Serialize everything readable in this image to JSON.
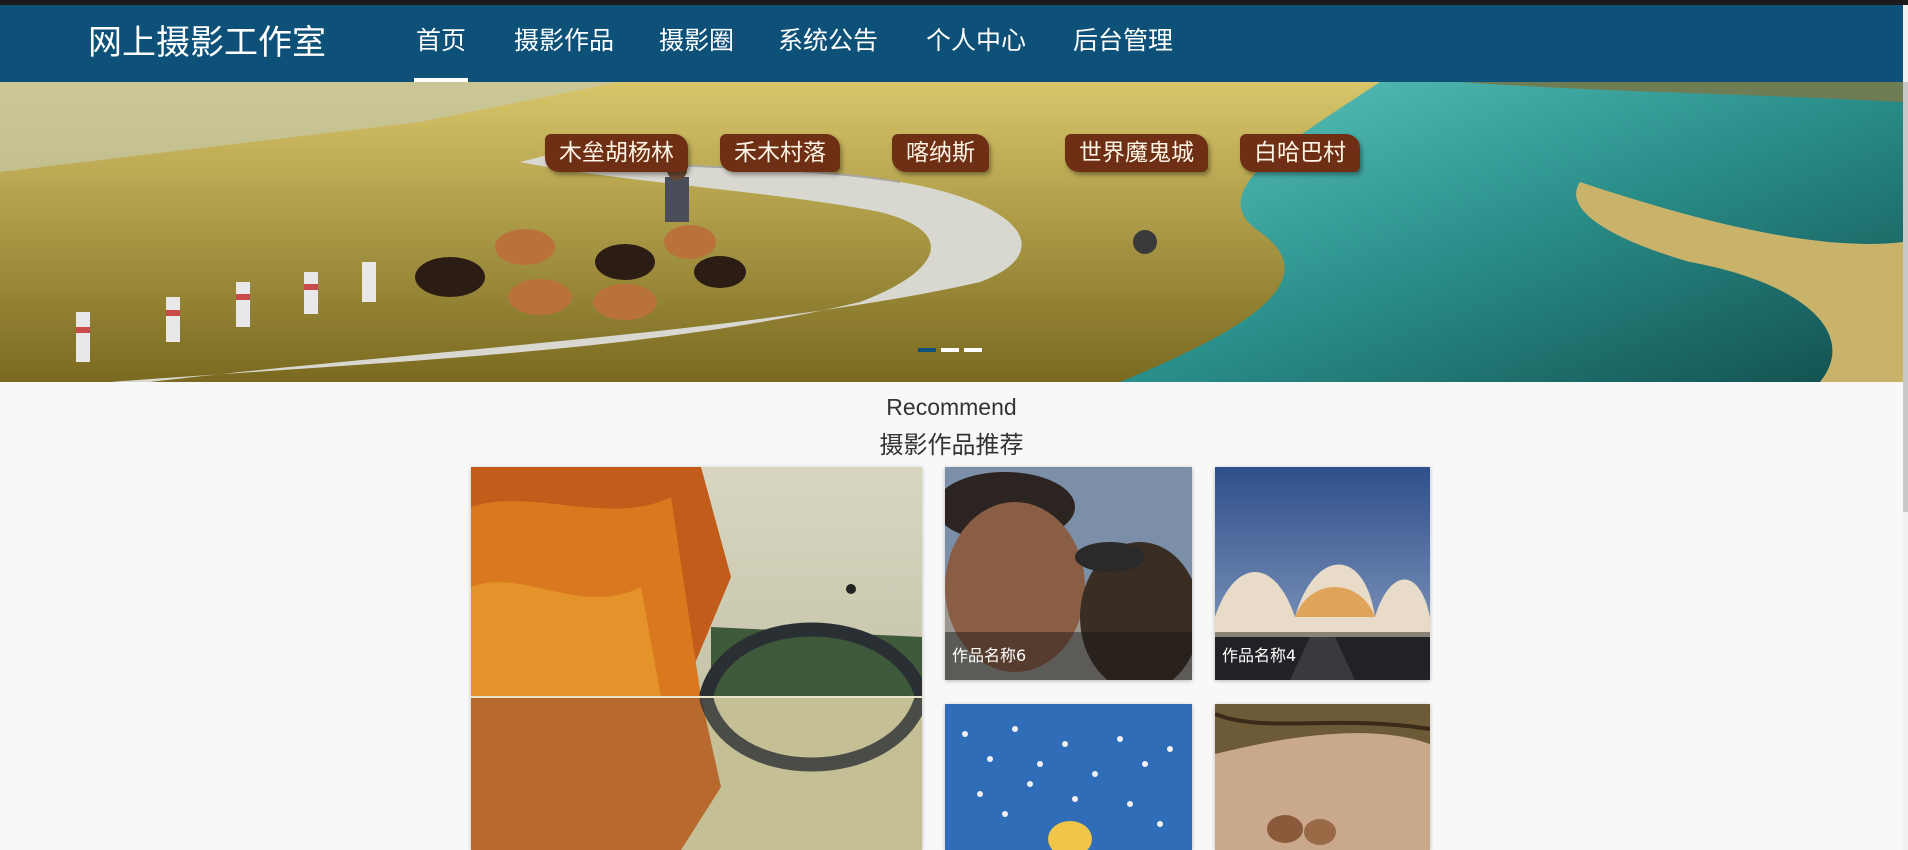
{
  "header": {
    "brand": "网上摄影工作室",
    "nav": [
      {
        "label": "首页",
        "active": true
      },
      {
        "label": "摄影作品",
        "active": false
      },
      {
        "label": "摄影圈",
        "active": false
      },
      {
        "label": "系统公告",
        "active": false
      },
      {
        "label": "个人中心",
        "active": false
      },
      {
        "label": "后台管理",
        "active": false
      }
    ]
  },
  "banner": {
    "tags": [
      "木垒胡杨林",
      "禾木村落",
      "喀纳斯",
      "世界魔鬼城",
      "白哈巴村"
    ],
    "slides": 3,
    "active_slide": 1,
    "colors": {
      "active": "#0d5179",
      "inactive": "#ffffff"
    }
  },
  "recommend": {
    "title_en": "Recommend",
    "title_cn": "摄影作品推荐",
    "works": [
      {
        "name": "",
        "image": "autumn-bridge-reflection"
      },
      {
        "name": "作品名称6",
        "image": "old-man-with-eagle"
      },
      {
        "name": "作品名称4",
        "image": "modern-architecture-dusk"
      },
      {
        "name": "",
        "image": "birds-flock-blue-sky"
      },
      {
        "name": "",
        "image": "deer-in-forest"
      }
    ]
  },
  "colors": {
    "nav_bg": "#0d5179",
    "page_bg": "#f8f8f8"
  }
}
